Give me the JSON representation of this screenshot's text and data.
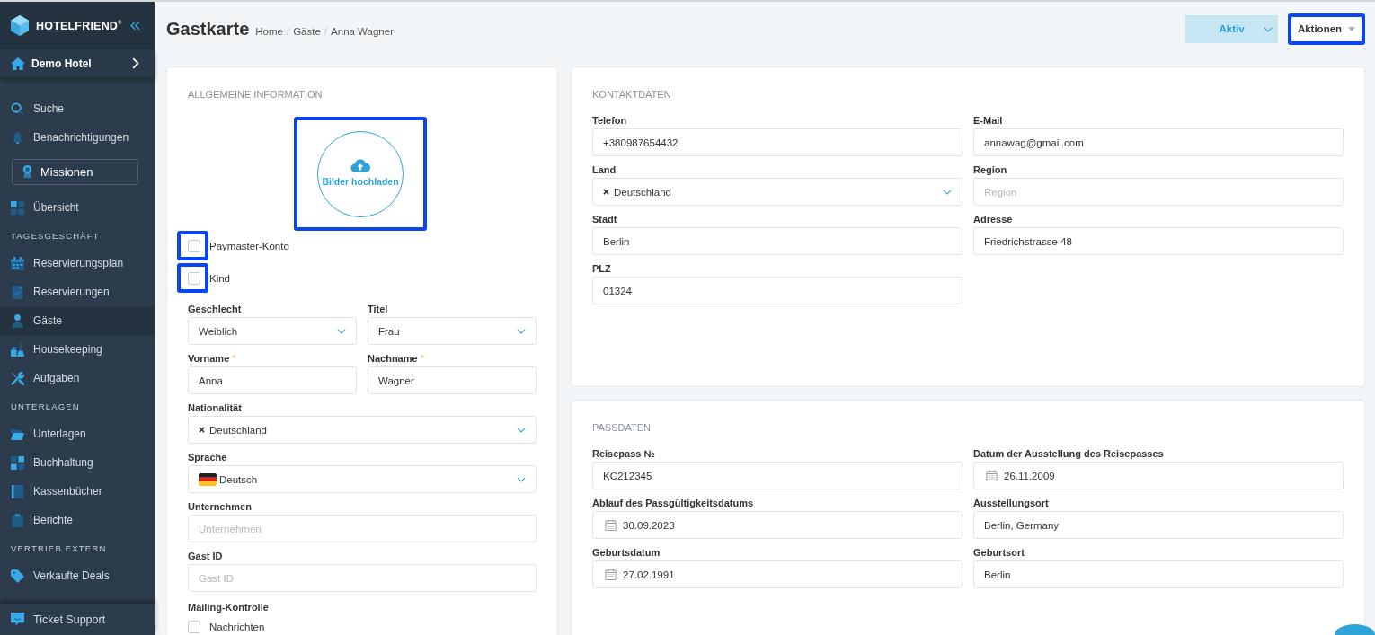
{
  "sidebar": {
    "brand": "HOTELFRIEND$^{®}$",
    "hotel": "Demo Hotel",
    "groups": [
      {
        "items": [
          {
            "kind": "link",
            "label": "Suche",
            "selected": false
          },
          {
            "kind": "link",
            "label": "Benachrichtigungen",
            "selected": false
          },
          {
            "kind": "outlined",
            "label": "Missionen",
            "selected": false
          },
          {
            "kind": "link",
            "label": "Übersicht",
            "selected": false
          }
        ]
      },
      {
        "heading": "TAGESGESCHÄFT",
        "items": [
          {
            "kind": "link",
            "label": "Reservierungsplan",
            "selected": false
          },
          {
            "kind": "link",
            "label": "Reservierungen",
            "selected": false
          },
          {
            "kind": "link",
            "label": "Gäste",
            "selected": true
          },
          {
            "kind": "link",
            "label": "Housekeeping",
            "selected": false
          },
          {
            "kind": "link",
            "label": "Aufgaben",
            "selected": false
          }
        ]
      },
      {
        "heading": "UNTERLAGEN",
        "items": [
          {
            "kind": "link",
            "label": "Unterlagen",
            "selected": false
          },
          {
            "kind": "link",
            "label": "Buchhaltung",
            "selected": false
          },
          {
            "kind": "link",
            "label": "Kassenbücher",
            "selected": false
          },
          {
            "kind": "link",
            "label": "Berichte",
            "selected": false
          }
        ]
      },
      {
        "heading": "VERTRIEB EXTERN",
        "items": [
          {
            "kind": "link",
            "label": "Verkaufte Deals",
            "selected": false
          }
        ]
      }
    ],
    "footer": "Ticket Support"
  },
  "header": {
    "title": "Gastkarte",
    "breadcrumb": [
      "Home",
      "Gäste",
      "Anna Wagner"
    ],
    "separator": "/",
    "status": "Aktiv",
    "actions": {
      "label": "Aktionen",
      "highlighted": true
    }
  },
  "general": {
    "title": "ALLGEMEINE INFORMATION",
    "upload": {
      "label": "Bilder hochladen",
      "highlighted": true
    },
    "checkboxes": [
      {
        "label": "Paymaster-Konto",
        "checked": false,
        "highlighted": true
      },
      {
        "label": "Kind",
        "checked": false,
        "highlighted": true
      }
    ],
    "rows": [
      [
        {
          "kind": "select",
          "label": "Geschlecht",
          "value": "Weiblich"
        },
        {
          "kind": "select",
          "label": "Titel",
          "value": "Frau"
        }
      ],
      [
        {
          "kind": "text",
          "label": "Vorname",
          "required_mark": "*",
          "value": "Anna"
        },
        {
          "kind": "text",
          "label": "Nachname",
          "required_mark": "*",
          "value": "Wagner"
        }
      ],
      [
        {
          "kind": "tag-select",
          "label": "Nationalität",
          "value": "Deutschland"
        }
      ],
      [
        {
          "kind": "flag-select",
          "label": "Sprache",
          "value": "Deutsch"
        }
      ],
      [
        {
          "kind": "text",
          "label": "Unternehmen",
          "placeholder": "Unternehmen"
        }
      ],
      [
        {
          "kind": "text",
          "label": "Gast ID",
          "placeholder": "Gast ID"
        }
      ]
    ],
    "mailing": {
      "label": "Mailing-Kontrolle",
      "options": [
        {
          "label": "Nachrichten",
          "checked": false
        }
      ]
    }
  },
  "contact": {
    "title": "KONTAKTDATEN",
    "rows": [
      [
        {
          "kind": "text",
          "label": "Telefon",
          "value": "+380987654432"
        },
        {
          "kind": "text",
          "label": "E-Mail",
          "value": "annawag@gmail.com"
        }
      ],
      [
        {
          "kind": "tag-select",
          "label": "Land",
          "value": "Deutschland"
        },
        {
          "kind": "text",
          "label": "Region",
          "placeholder": "Region"
        }
      ],
      [
        {
          "kind": "text",
          "label": "Stadt",
          "value": "Berlin"
        },
        {
          "kind": "text",
          "label": "Adresse",
          "value": "Friedrichstrasse 48"
        }
      ],
      [
        {
          "kind": "text",
          "label": "PLZ",
          "value": "01324"
        }
      ]
    ]
  },
  "passport": {
    "title": "PASSDATEN",
    "rows": [
      [
        {
          "kind": "text",
          "label": "Reisepass №",
          "value": "KC212345"
        },
        {
          "kind": "date",
          "label": "Datum der Ausstellung des Reisepasses",
          "value": "26.11.2009"
        }
      ],
      [
        {
          "kind": "date",
          "label": "Ablauf des Passgültigkeitsdatums",
          "value": "30.09.2023"
        },
        {
          "kind": "text",
          "label": "Ausstellungsort",
          "value": "Berlin, Germany"
        }
      ],
      [
        {
          "kind": "date",
          "label": "Geburtsdatum",
          "value": "27.02.1991"
        },
        {
          "kind": "text",
          "label": "Geburtsort",
          "value": "Berlin"
        }
      ]
    ]
  }
}
